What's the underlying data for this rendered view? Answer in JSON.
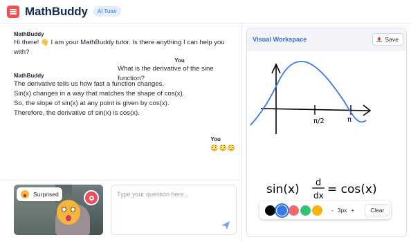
{
  "header": {
    "title": "MathBuddy",
    "badge": "AI Tutor"
  },
  "chat": {
    "messages": [
      {
        "sender": "MathBuddy",
        "role": "bot",
        "lines": [
          "Hi there! 👋 I am your MathBuddy tutor. Is there anything I can help you with?"
        ]
      },
      {
        "sender": "You",
        "role": "user",
        "lines": [
          "What is the derivative of the sine function?"
        ]
      },
      {
        "sender": "MathBuddy",
        "role": "bot",
        "lines": [
          "The derivative tells us how fast a function changes.",
          "Sin(x) changes in a way that matches the shape of cos(x).",
          "So, the slope of sin(x) at any point is given by cos(x).",
          "Therefore, the derivative of sin(x) is cos(x)."
        ]
      },
      {
        "sender": "You",
        "role": "user",
        "lines": [
          "😳😳😳"
        ]
      }
    ]
  },
  "camera": {
    "emotion_label": "Surprised",
    "emotion_icon": "surprised-emoji-icon",
    "record_icon": "record-icon"
  },
  "input": {
    "placeholder": "Type your question here...",
    "value": "",
    "send_icon": "send-icon"
  },
  "workspace": {
    "title": "Visual Workspace",
    "save_label": "Save",
    "save_icon": "save-icon",
    "drawing": {
      "pi_over_2": "π/2",
      "pi": "π",
      "equation_left": "sin(x)",
      "d_over_dx_top": "d",
      "d_over_dx_bottom": "dx",
      "equation_right": "= cos(x)"
    },
    "toolbar": {
      "colors": [
        "#000000",
        "#3b78e7",
        "#f26b6b",
        "#34c17a",
        "#f5b400"
      ],
      "selected_color": "#3b78e7",
      "size_label": "3px",
      "decrease_label": "-",
      "increase_label": "+",
      "clear_label": "Clear"
    }
  }
}
